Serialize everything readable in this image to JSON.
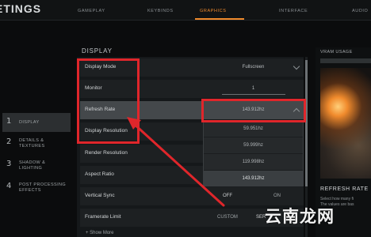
{
  "header": {
    "title": "ETINGS",
    "tabs": [
      {
        "label": "GAMEPLAY",
        "active": false
      },
      {
        "label": "KEYBINDS",
        "active": false
      },
      {
        "label": "GRAPHICS",
        "active": true
      },
      {
        "label": "INTERFACE",
        "active": false
      },
      {
        "label": "AUDIO",
        "active": false
      }
    ]
  },
  "categories": [
    {
      "num": "1",
      "label": "DISPLAY",
      "active": true
    },
    {
      "num": "2",
      "label": "DETAILS & TEXTURES",
      "active": false
    },
    {
      "num": "3",
      "label": "SHADOW & LIGHTING",
      "active": false
    },
    {
      "num": "4",
      "label": "POST PROCESSING EFFECTS",
      "active": false
    }
  ],
  "section": {
    "title": "DISPLAY"
  },
  "settings": [
    {
      "label": "Display Mode",
      "value": "Fullscreen"
    },
    {
      "label": "Monitor",
      "value": "1"
    },
    {
      "label": "Refresh Rate",
      "value": "143.912hz"
    },
    {
      "label": "Display Resolution",
      "value": ""
    },
    {
      "label": "Render Resolution",
      "value": ""
    },
    {
      "label": "Aspect Ratio",
      "value": ""
    },
    {
      "label": "Vertical Sync",
      "off": "OFF",
      "on": "ON"
    },
    {
      "label": "Framerate Limit",
      "custom": "CUSTOM",
      "server": "SER"
    }
  ],
  "dropdown": {
    "options": [
      "59.951hz",
      "59.999hz",
      "119.998hz",
      "143.912hz"
    ],
    "selected": "143.912hz"
  },
  "show_more": "+ Show More",
  "preview": {
    "vram_label": "VRAM USAGE",
    "title": "REFRESH RATE",
    "desc_line1": "Select how many fi",
    "desc_line2": "The values are bas"
  },
  "watermark": "云南龙网",
  "colors": {
    "accent": "#f08a2c",
    "annotation": "#e0262b"
  }
}
